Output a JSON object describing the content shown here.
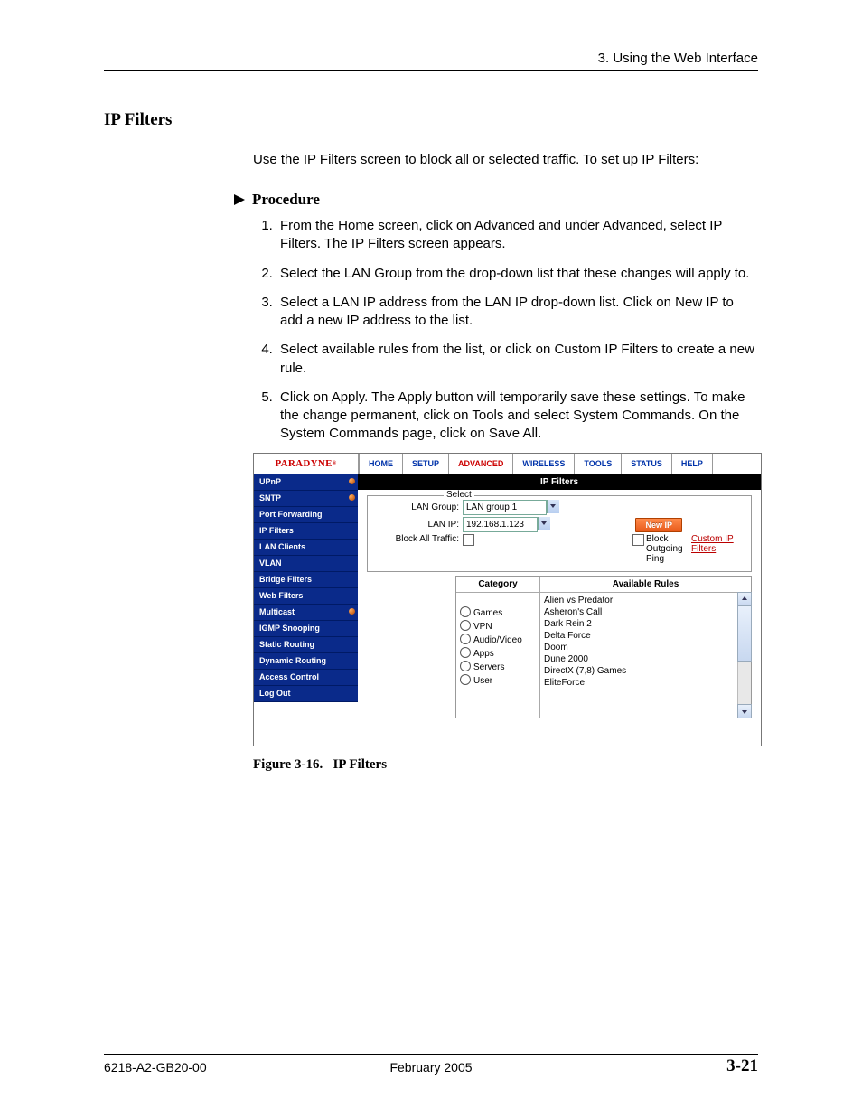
{
  "header": {
    "chapter": "3. Using the Web Interface"
  },
  "section": {
    "title": "IP Filters"
  },
  "intro": "Use the IP Filters screen to block all or selected traffic. To set up IP Filters:",
  "procedure": {
    "heading": "Procedure",
    "steps": [
      "From the Home screen, click on Advanced and under Advanced, select IP Filters. The IP Filters screen appears.",
      "Select the LAN Group from the drop-down list that these changes will apply to.",
      "Select a LAN IP address from the LAN IP drop-down list. Click on New IP to add a new IP address to the list.",
      " Select available rules from the list, or click on Custom IP Filters to create a new rule.",
      "Click on Apply. The Apply button will temporarily save these settings. To make the change permanent, click on Tools and select System Commands. On the System Commands page, click on Save All."
    ]
  },
  "screenshot": {
    "brand": "PARADYNE",
    "tabs": [
      "HOME",
      "SETUP",
      "ADVANCED",
      "WIRELESS",
      "TOOLS",
      "STATUS",
      "HELP"
    ],
    "active_tab_index": 2,
    "sidebar": [
      {
        "label": "UPnP",
        "dot": true
      },
      {
        "label": "SNTP",
        "dot": true
      },
      {
        "label": "Port Forwarding",
        "dot": false
      },
      {
        "label": "IP Filters",
        "dot": false
      },
      {
        "label": "LAN Clients",
        "dot": false
      },
      {
        "label": "VLAN",
        "dot": false
      },
      {
        "label": "Bridge Filters",
        "dot": false
      },
      {
        "label": "Web Filters",
        "dot": false
      },
      {
        "label": "Multicast",
        "dot": true
      },
      {
        "label": "IGMP Snooping",
        "dot": false
      },
      {
        "label": "Static Routing",
        "dot": false
      },
      {
        "label": "Dynamic Routing",
        "dot": false
      },
      {
        "label": "Access Control",
        "dot": false
      },
      {
        "label": "Log Out",
        "dot": false
      }
    ],
    "panel_title": "IP Filters",
    "form": {
      "legend": "Select",
      "lan_group_label": "LAN Group:",
      "lan_group_value": "LAN group 1",
      "lan_ip_label": "LAN IP:",
      "lan_ip_value": "192.168.1.123",
      "new_ip_button": "New IP",
      "block_all_label": "Block All Traffic:",
      "block_ping_label": "Block Outgoing Ping",
      "custom_link": "Custom IP Filters"
    },
    "category": {
      "header": "Category",
      "items": [
        "Games",
        "VPN",
        "Audio/Video",
        "Apps",
        "Servers",
        "User"
      ]
    },
    "rules": {
      "header": "Available Rules",
      "items": [
        "Alien vs Predator",
        "Asheron's Call",
        "Dark Rein 2",
        "Delta Force",
        "Doom",
        "Dune 2000",
        "DirectX (7,8) Games",
        "EliteForce"
      ]
    }
  },
  "figure": {
    "number": "Figure 3-16.",
    "title": "IP Filters"
  },
  "footer": {
    "left": "6218-A2-GB20-00",
    "center": "February 2005",
    "right": "3-21"
  }
}
